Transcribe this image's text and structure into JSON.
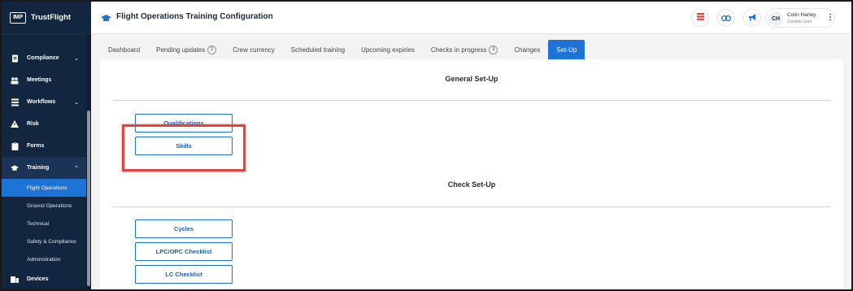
{
  "brand": {
    "logo_text": "IMP",
    "name": "TrustFlight"
  },
  "sidebar": {
    "items": [
      {
        "label": "Compliance",
        "icon": "document-icon",
        "expandable": true
      },
      {
        "label": "Meetings",
        "icon": "people-icon",
        "expandable": false
      },
      {
        "label": "Workflows",
        "icon": "list-icon",
        "expandable": true
      },
      {
        "label": "Risk",
        "icon": "warning-icon",
        "expandable": false
      },
      {
        "label": "Forms",
        "icon": "clipboard-icon",
        "expandable": false
      },
      {
        "label": "Training",
        "icon": "graduation-cap-icon",
        "expandable": true,
        "expanded": true
      }
    ],
    "training_children": [
      {
        "label": "Flight Operations",
        "active": true
      },
      {
        "label": "Ground Operations"
      },
      {
        "label": "Technical"
      },
      {
        "label": "Safety & Compliance"
      },
      {
        "label": "Administration"
      }
    ],
    "devices": {
      "label": "Devices",
      "icon": "devices-icon"
    }
  },
  "header": {
    "title": "Flight Operations Training Configuration",
    "user": {
      "initials": "CH",
      "name": "Colin Harley",
      "role": "Centrik User"
    }
  },
  "tabs": [
    {
      "label": "Dashboard"
    },
    {
      "label": "Pending updates",
      "badge": "2"
    },
    {
      "label": "Crew currency"
    },
    {
      "label": "Scheduled training"
    },
    {
      "label": "Upcoming expiries"
    },
    {
      "label": "Checks in progress",
      "badge": "3"
    },
    {
      "label": "Changes"
    },
    {
      "label": "Set-Up",
      "active": true
    }
  ],
  "general_setup": {
    "title": "General Set-Up",
    "buttons": [
      "Qualifications",
      "Skills"
    ]
  },
  "check_setup": {
    "title": "Check Set-Up",
    "buttons": [
      "Cycles",
      "LPC/OPC Checklist",
      "LC Checklist"
    ]
  },
  "colors": {
    "sidebar_bg": "#12263f",
    "accent": "#1e73d6",
    "highlight": "#e0453f"
  }
}
